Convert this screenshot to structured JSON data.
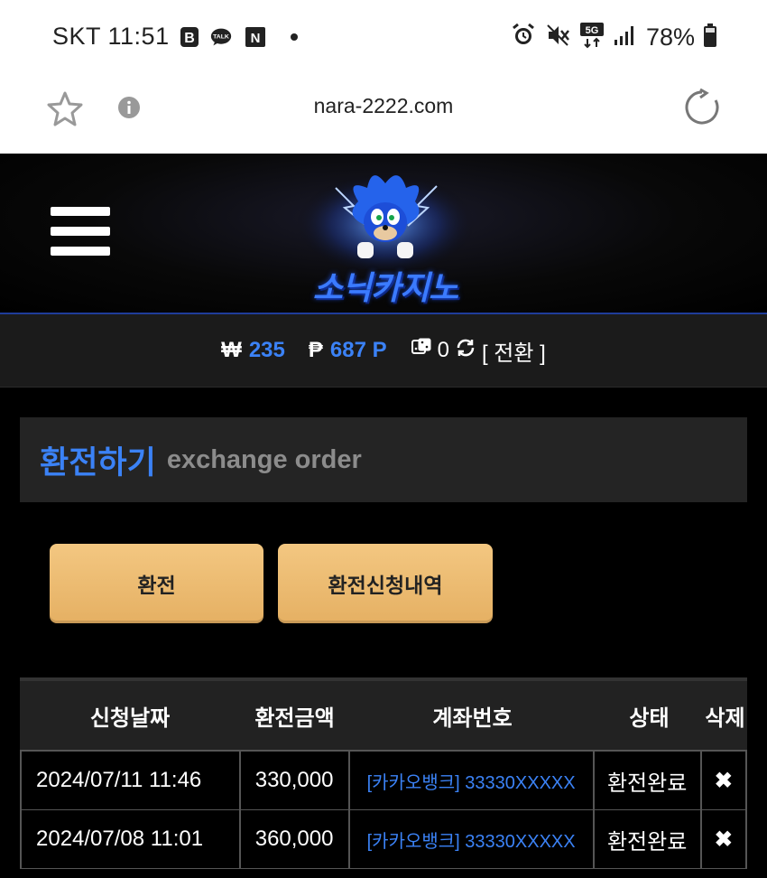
{
  "status_bar": {
    "carrier_time": "SKT 11:51",
    "battery": "78%",
    "network": "5G"
  },
  "browser": {
    "url": "nara-2222.com"
  },
  "site": {
    "logo_text": "소닉카지노"
  },
  "balance": {
    "won_symbol": "₩",
    "won_value": "235",
    "point_symbol": "₱",
    "point_value": "687 P",
    "dice_value": "0",
    "switch_label": "[ 전환 ]"
  },
  "panel": {
    "title_ko": "환전하기",
    "title_en": "exchange order"
  },
  "buttons": {
    "exchange": "환전",
    "history": "환전신청내역"
  },
  "table": {
    "headers": [
      "신청날짜",
      "환전금액",
      "계좌번호",
      "상태",
      "삭제"
    ],
    "rows": [
      {
        "date": "2024/07/11 11:46",
        "amount": "330,000",
        "account": "[카카오뱅크] 33330XXXXX",
        "status": "환전완료",
        "delete": "✖"
      },
      {
        "date": "2024/07/08 11:01",
        "amount": "360,000",
        "account": "[카카오뱅크] 33330XXXXX",
        "status": "환전완료",
        "delete": "✖"
      }
    ]
  },
  "colors": {
    "accent": "#3b82f6",
    "button": "#eab66b",
    "panel_bg": "#242424"
  }
}
